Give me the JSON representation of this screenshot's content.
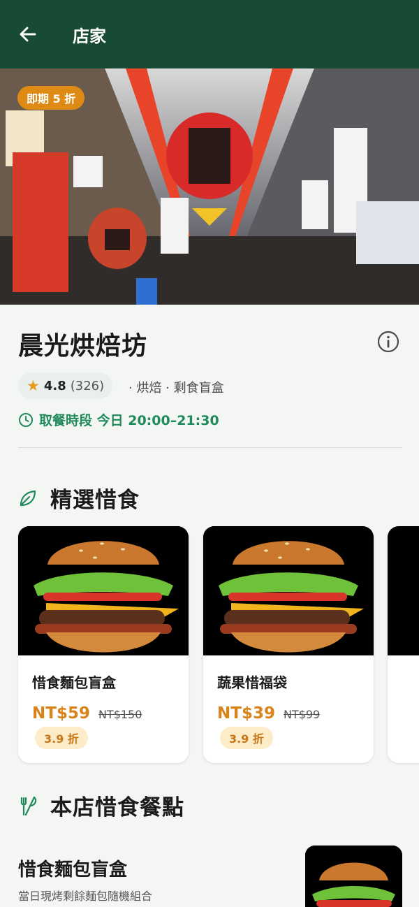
{
  "header": {
    "title": "店家"
  },
  "hero": {
    "badge": "即期 5 折"
  },
  "store": {
    "name": "晨光烘焙坊",
    "rating": "4.8",
    "rating_count": "(326)",
    "meta": "· 烘焙 · 剩食盲盒",
    "pickup": "取餐時段 今日 20:00–21:30"
  },
  "featured": {
    "title": "精選惜食",
    "items": [
      {
        "name": "惜食麵包盲盒",
        "price": "NT$59",
        "original_price": "NT$150",
        "discount": "3.9 折"
      },
      {
        "name": "蔬果惜福袋",
        "price": "NT$39",
        "original_price": "NT$99",
        "discount": "3.9 折"
      }
    ]
  },
  "menu": {
    "title": "本店惜食餐點",
    "items": [
      {
        "name": "惜食麵包盲盒",
        "description": "當日現烤剩餘麵包隨機組合"
      }
    ]
  },
  "colors": {
    "header": "#184b33",
    "accent_green": "#1f8a5a",
    "price_orange": "#d9831b",
    "badge_orange": "#e08a16"
  },
  "icons": [
    "back-arrow-icon",
    "info-icon",
    "star-icon",
    "clock-icon",
    "leaf-icon",
    "utensils-icon"
  ]
}
